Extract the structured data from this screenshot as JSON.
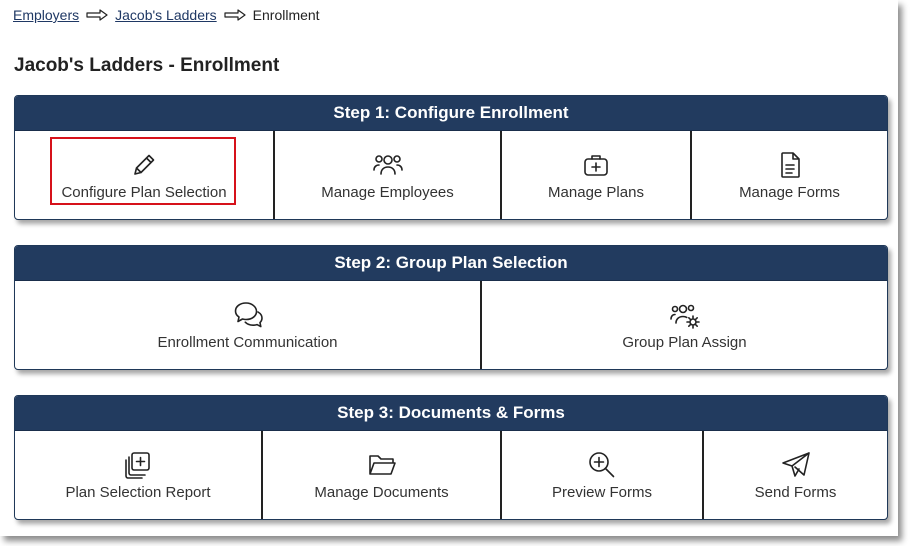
{
  "breadcrumb": {
    "items": [
      {
        "label": "Employers"
      },
      {
        "label": "Jacob's Ladders"
      }
    ],
    "current": "Enrollment"
  },
  "page": {
    "title": "Jacob's Ladders - Enrollment"
  },
  "steps": [
    {
      "title": "Step 1: Configure Enrollment",
      "tiles": [
        {
          "label": "Configure Plan Selection",
          "icon": "pencil-icon",
          "highlighted": true
        },
        {
          "label": "Manage Employees",
          "icon": "users-icon"
        },
        {
          "label": "Manage Plans",
          "icon": "medical-kit-icon"
        },
        {
          "label": "Manage Forms",
          "icon": "document-icon"
        }
      ]
    },
    {
      "title": "Step 2: Group Plan Selection",
      "tiles": [
        {
          "label": "Enrollment Communication",
          "icon": "chat-bubbles-icon"
        },
        {
          "label": "Group Plan Assign",
          "icon": "users-gear-icon"
        }
      ]
    },
    {
      "title": "Step 3: Documents & Forms",
      "tiles": [
        {
          "label": "Plan Selection Report",
          "icon": "copy-plus-icon"
        },
        {
          "label": "Manage Documents",
          "icon": "folder-open-icon"
        },
        {
          "label": "Preview Forms",
          "icon": "zoom-in-icon"
        },
        {
          "label": "Send Forms",
          "icon": "paper-plane-icon"
        }
      ]
    }
  ],
  "colors": {
    "header_bg": "#223b5f",
    "highlight": "#d6111a",
    "link": "#1f3864"
  }
}
